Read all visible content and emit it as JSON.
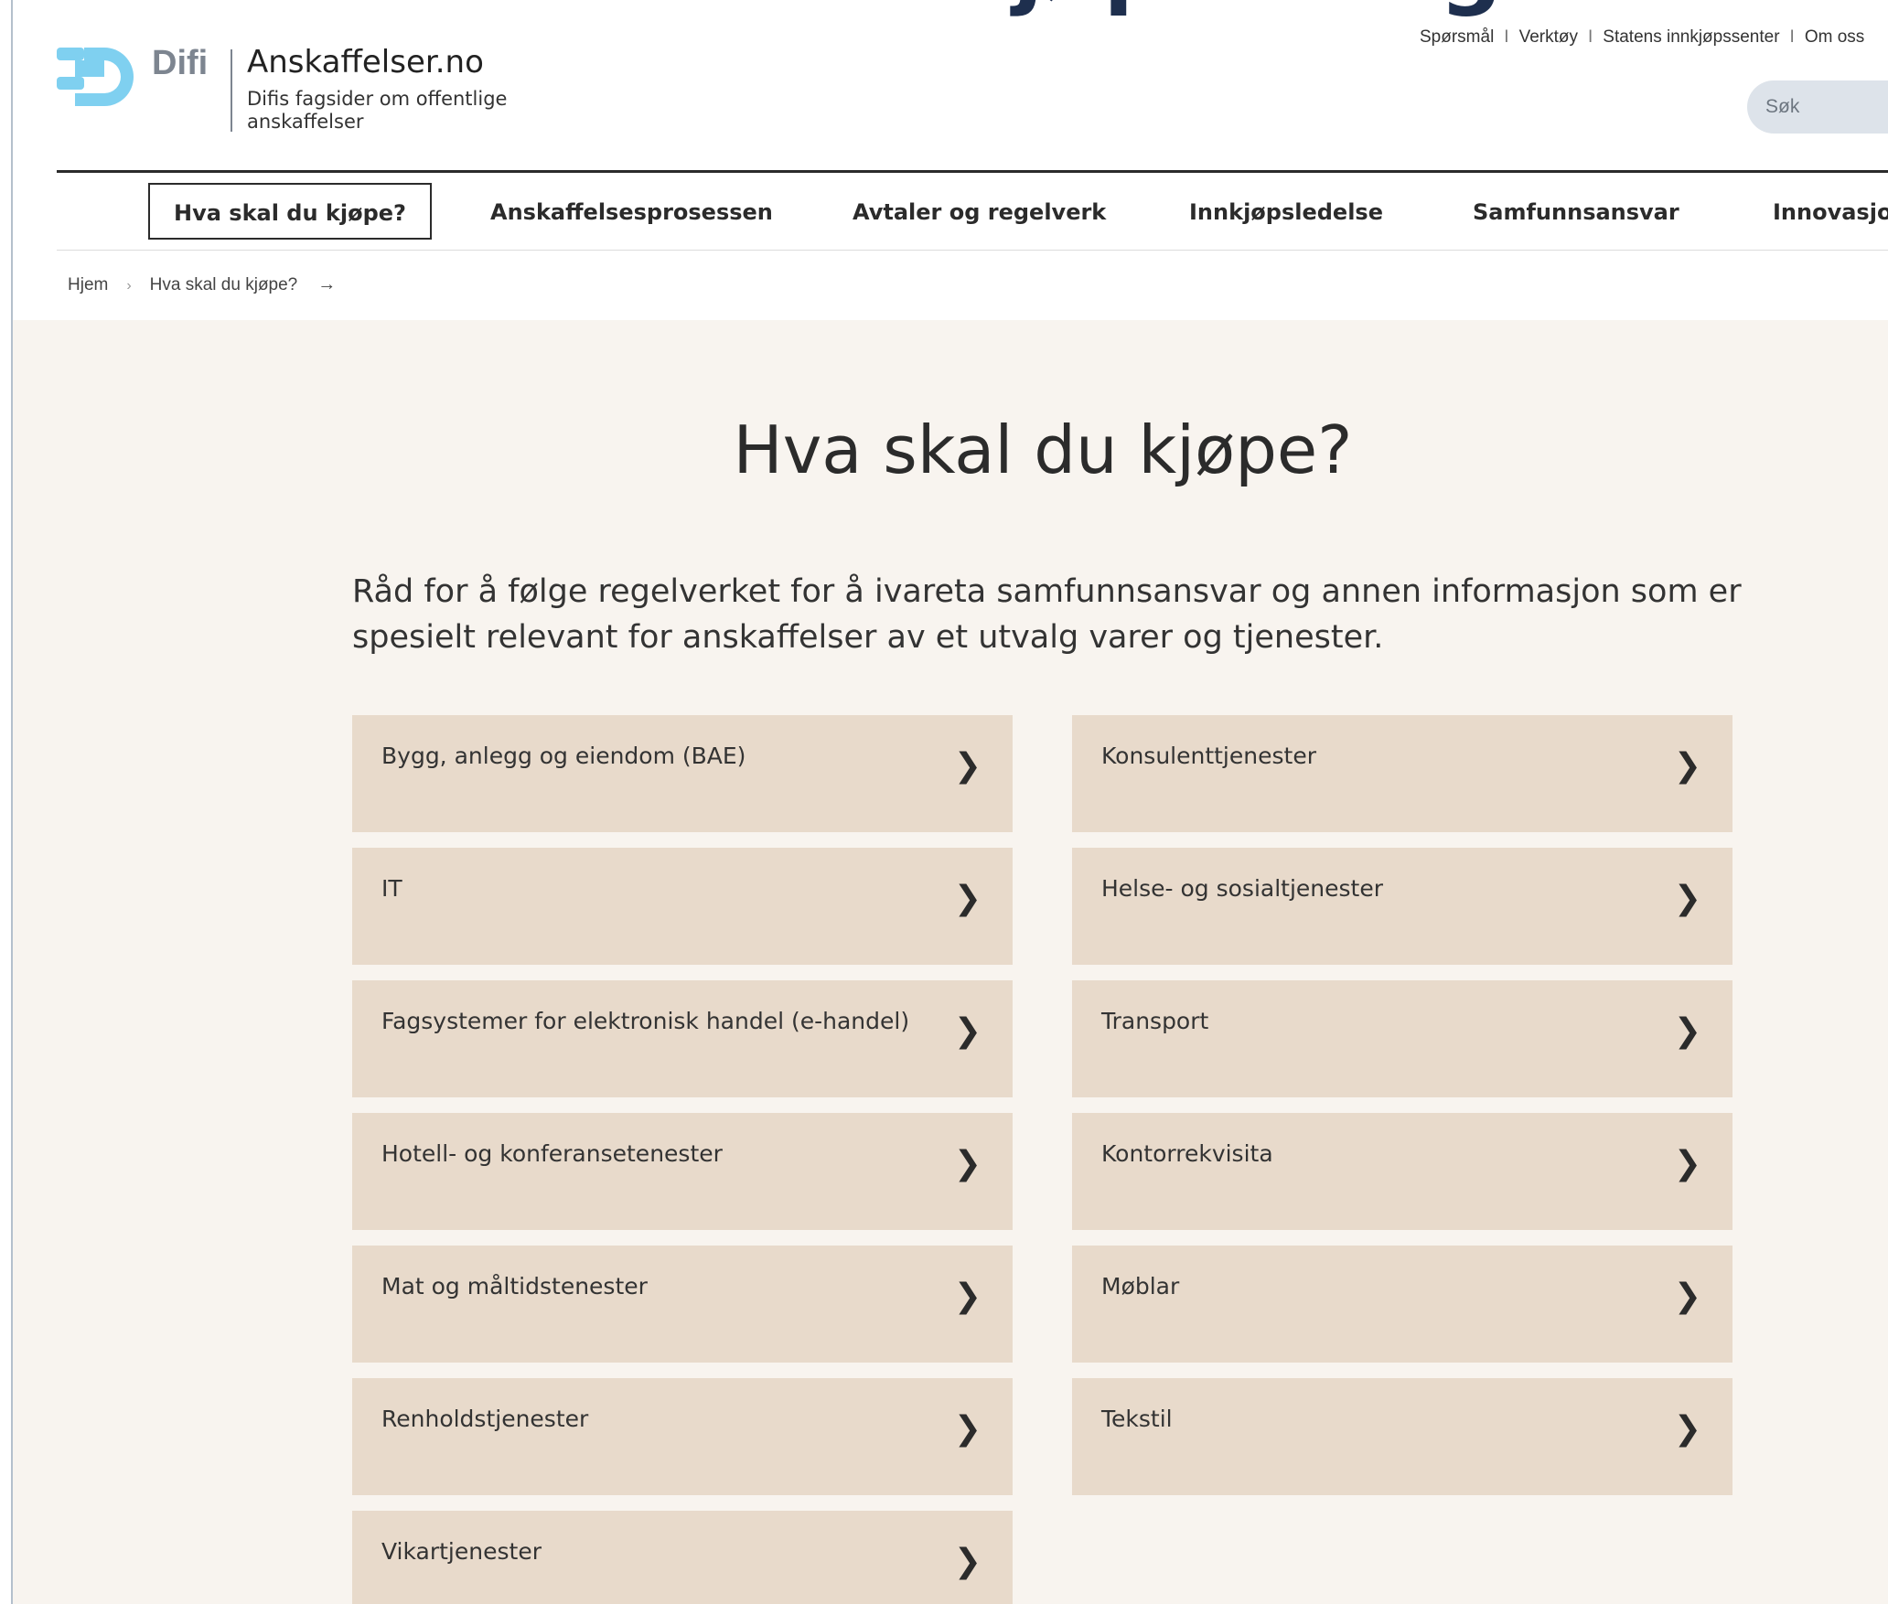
{
  "top_crop_heading": "Hva skal du kjøpe i dag?",
  "brand": {
    "difi": "Difi",
    "title": "Anskaffelser.no",
    "tagline": "Difis fagsider om offentlige anskaffelser"
  },
  "utility_nav": [
    "Spørsmål",
    "Verktøy",
    "Statens innkjøpssenter",
    "Om oss"
  ],
  "utility_separator": "I",
  "search": {
    "placeholder": "Søk"
  },
  "main_nav": [
    {
      "label": "Hva skal du kjøpe?",
      "active": true
    },
    {
      "label": "Anskaffelsesprosessen"
    },
    {
      "label": "Avtaler og regelverk"
    },
    {
      "label": "Innkjøpsledelse"
    },
    {
      "label": "Samfunnsansvar"
    },
    {
      "label": "Innovasjon"
    }
  ],
  "breadcrumb": {
    "home": "Hjem",
    "chevron": "›",
    "current": "Hva skal du kjøpe?",
    "arrow": "→"
  },
  "page": {
    "title": "Hva skal du kjøpe?",
    "lead": "Råd for å følge regelverket for å ivareta samfunnsansvar og annen informasjon som er spesielt relevant for anskaffelser av et utvalg varer og tjenester."
  },
  "categories_left": [
    "Bygg, anlegg og eiendom (BAE)",
    "IT",
    "Fagsystemer for elektronisk handel (e-handel)",
    "Hotell- og konferansetenester",
    "Mat og måltidstenester",
    "Renholdstjenester",
    "Vikartjenester"
  ],
  "categories_right": [
    "Konsulenttjenester",
    "Helse- og sosialtjenester",
    "Transport",
    "Kontorrekvisita",
    "Møblar",
    "Tekstil"
  ],
  "card_chevron": "❯",
  "colors": {
    "card_bg": "#e8dacb",
    "content_bg": "#f8f4ef",
    "logo_blue": "#7fd0f0",
    "difi_grey": "#7d8590",
    "search_bg": "#dde3ea"
  }
}
